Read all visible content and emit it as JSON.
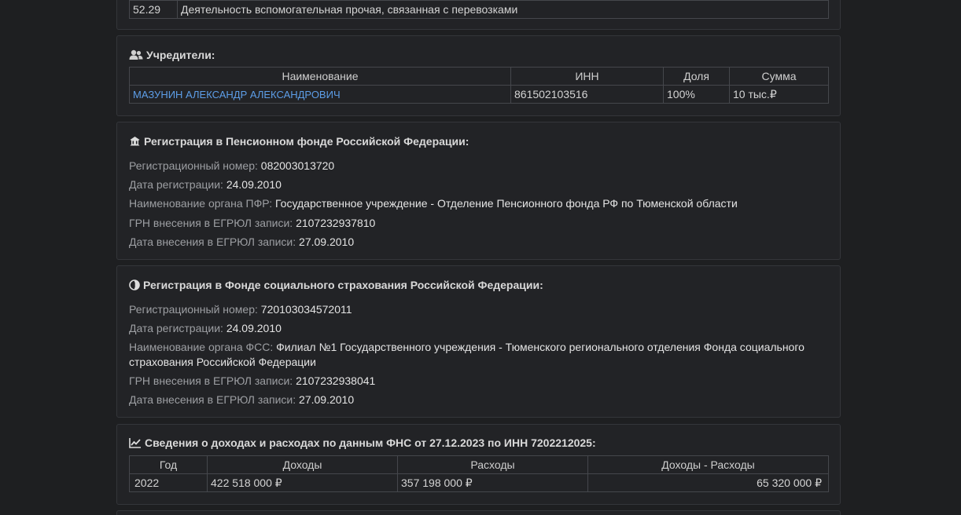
{
  "okved": {
    "code": "52.29",
    "name": "Деятельность вспомогательная прочая, связанная с перевозками"
  },
  "founders": {
    "title": "Учредители:",
    "headers": [
      "Наименование",
      "ИНН",
      "Доля",
      "Сумма"
    ],
    "rows": [
      {
        "name": "МАЗУНИН АЛЕКСАНДР АЛЕКСАНДРОВИЧ",
        "inn": "861502103516",
        "share": "100%",
        "sum": "10 тыс.₽"
      }
    ]
  },
  "pfr": {
    "title": "Регистрация в Пенсионном фонде Российской Федерации:",
    "reg_number_label": "Регистрационный номер:",
    "reg_number": "082003013720",
    "reg_date_label": "Дата регистрации:",
    "reg_date": "24.09.2010",
    "organ_label": "Наименование органа ПФР:",
    "organ": "Государственное учреждение - Отделение Пенсионного фонда РФ по Тюменской области",
    "grn_label": "ГРН внесения в ЕГРЮЛ записи:",
    "grn": "2107232937810",
    "entry_date_label": "Дата внесения в ЕГРЮЛ записи:",
    "entry_date": "27.09.2010"
  },
  "fss": {
    "title": "Регистрация в Фонде социального страхования Российской Федерации:",
    "reg_number_label": "Регистрационный номер:",
    "reg_number": "720103034572011",
    "reg_date_label": "Дата регистрации:",
    "reg_date": "24.09.2010",
    "organ_label": "Наименование органа ФСС:",
    "organ_line1": "Филиал №1 Государственного учреждения - Тюменского регионального отделения Фонда социального",
    "organ_line2": "страхования Российской Федерации",
    "grn_label": "ГРН внесения в ЕГРЮЛ записи:",
    "grn": "2107232938041",
    "entry_date_label": "Дата внесения в ЕГРЮЛ записи:",
    "entry_date": "27.09.2010"
  },
  "finance": {
    "title": "Сведения о доходах и расходах по данным ФНС от 27.12.2023 по ИНН 7202212025:",
    "headers": [
      "Год",
      "Доходы",
      "Расходы",
      "Доходы - Расходы"
    ],
    "rows": [
      {
        "year": "2022",
        "income": "422 518 000 ₽",
        "expenses": "357 198 000 ₽",
        "diff": "65 320 000 ₽"
      }
    ]
  },
  "icons": {
    "founders": "users-icon",
    "pfr": "pension-fund-icon",
    "fss": "social-insurance-icon",
    "finance": "chart-line-icon"
  }
}
